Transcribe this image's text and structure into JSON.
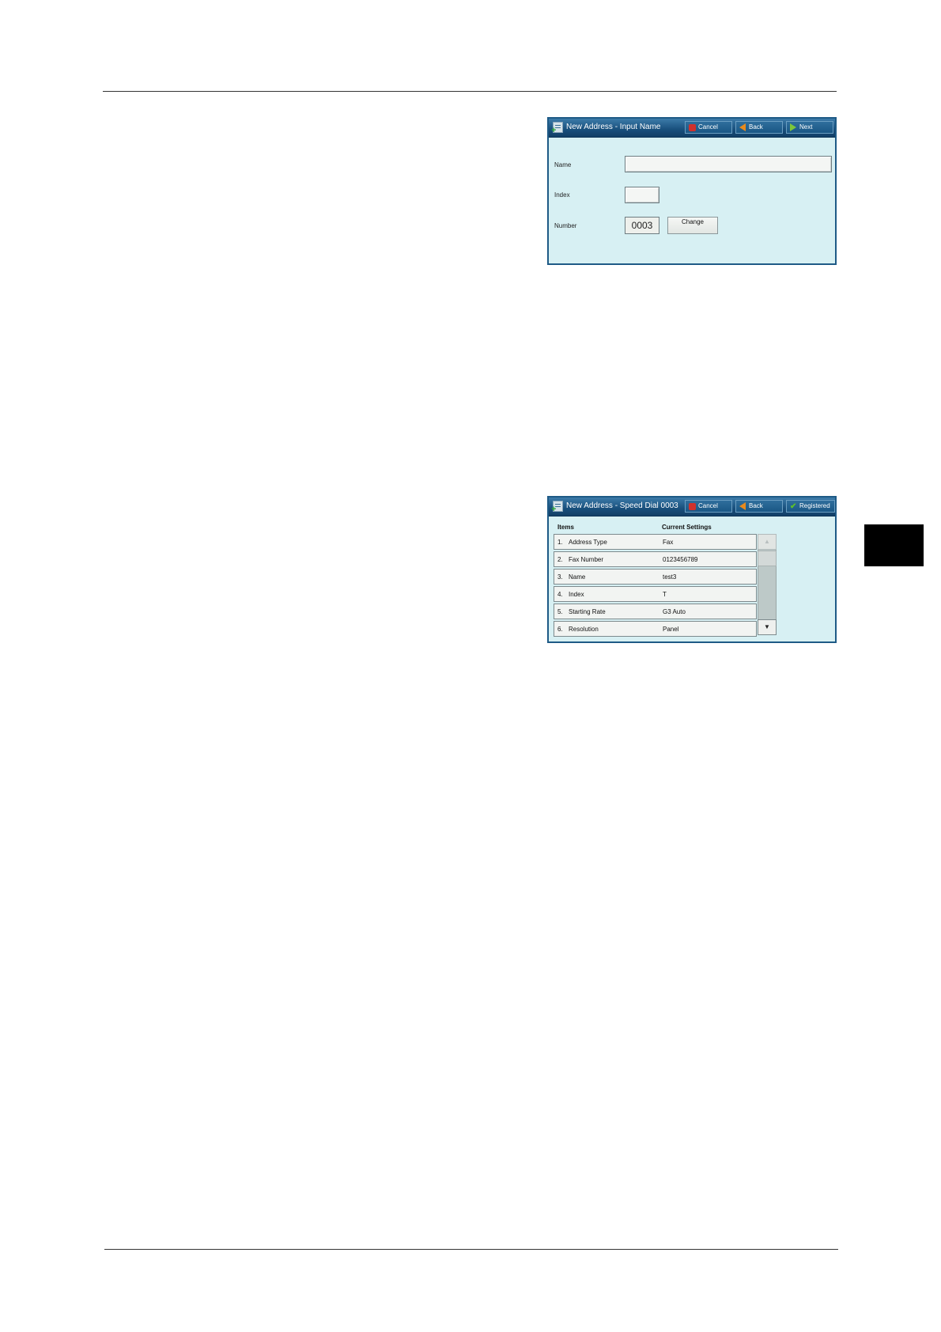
{
  "screen1": {
    "title": "New Address - Input Name",
    "buttons": {
      "cancel": "Cancel",
      "back": "Back",
      "next": "Next"
    },
    "fields": {
      "name_label": "Name",
      "index_label": "Index",
      "number_label": "Number",
      "number_value": "0003",
      "change_label": "Change"
    }
  },
  "screen2": {
    "title": "New Address - Speed Dial 0003",
    "buttons": {
      "cancel": "Cancel",
      "back": "Back",
      "registered": "Registered"
    },
    "columns": {
      "items": "Items",
      "current": "Current Settings"
    },
    "rows": [
      {
        "num": "1.",
        "item": "Address Type",
        "value": "Fax"
      },
      {
        "num": "2.",
        "item": "Fax Number",
        "value": "0123456789"
      },
      {
        "num": "3.",
        "item": "Name",
        "value": "test3"
      },
      {
        "num": "4.",
        "item": "Index",
        "value": "T"
      },
      {
        "num": "5.",
        "item": "Starting Rate",
        "value": "G3 Auto"
      },
      {
        "num": "6.",
        "item": "Resolution",
        "value": "Panel"
      }
    ],
    "scroll": {
      "up": "▲",
      "down": "▼"
    }
  }
}
